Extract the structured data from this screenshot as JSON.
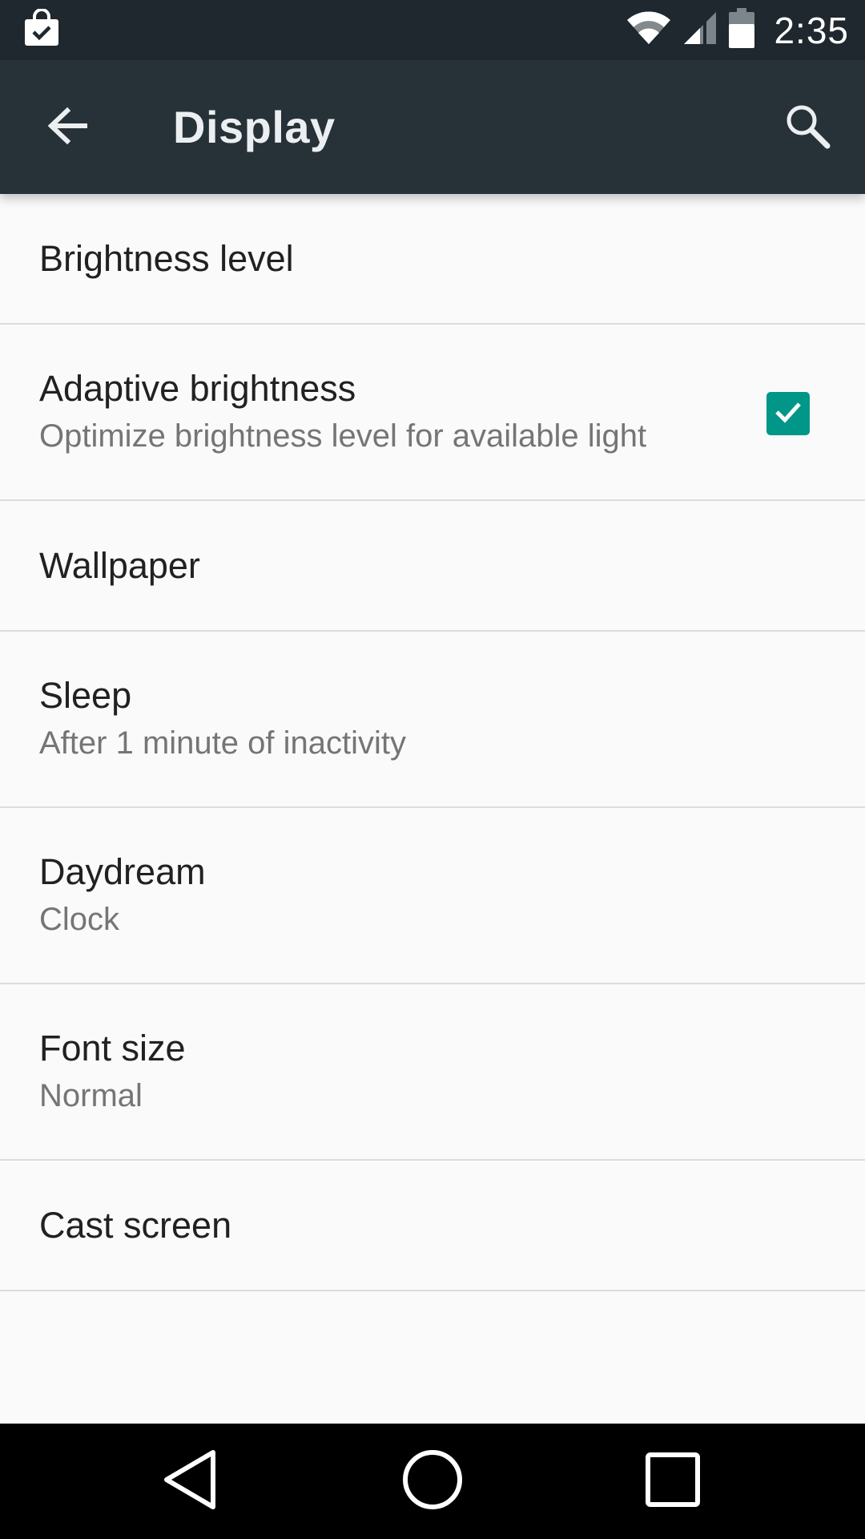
{
  "status_bar": {
    "time": "2:35",
    "icons": [
      "shopping-bag-check-icon",
      "wifi-icon",
      "cell-signal-icon",
      "battery-icon"
    ]
  },
  "app_bar": {
    "title": "Display",
    "back_icon": "arrow-left-icon",
    "search_icon": "search-icon"
  },
  "settings": {
    "items": [
      {
        "title": "Brightness level"
      },
      {
        "title": "Adaptive brightness",
        "summary": "Optimize brightness level for available light",
        "checked": true
      },
      {
        "title": "Wallpaper"
      },
      {
        "title": "Sleep",
        "summary": "After 1 minute of inactivity"
      },
      {
        "title": "Daydream",
        "summary": "Clock"
      },
      {
        "title": "Font size",
        "summary": "Normal"
      },
      {
        "title": "Cast screen"
      }
    ]
  },
  "nav_bar": {
    "icons": [
      "back-triangle-icon",
      "home-circle-icon",
      "recents-square-icon"
    ]
  },
  "colors": {
    "status_bar": "#1e282e",
    "app_bar": "#263238",
    "accent": "#009688",
    "background": "#fafafa",
    "divider": "#dcdcdc"
  }
}
